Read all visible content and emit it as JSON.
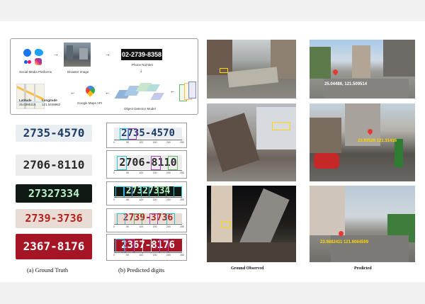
{
  "pipeline": {
    "social_label": "Social Media Platforms",
    "disaster_label": "Disaster Image",
    "phone_number": "02-2739-8358",
    "phone_label": "Phone Number",
    "detector_label": "Object Detector Model",
    "maps_label": "Google Maps API",
    "latitude_label": "Latitude",
    "latitude_value": "25.0385116",
    "longitude_label": "Longitude",
    "longitude_value": "121.5448962"
  },
  "plates": [
    {
      "gt": "2735-4570",
      "pred": "2735-4570"
    },
    {
      "gt": "2706-8110",
      "pred": "2706-8110"
    },
    {
      "gt": "27327334",
      "pred": "27327334"
    },
    {
      "gt": "2739-3736",
      "pred": "2739-3736"
    },
    {
      "gt": "2367-8176",
      "pred": "2367-8176"
    }
  ],
  "captions": {
    "a": "(a) Ground Truth",
    "b": "(b) Predicted digits"
  },
  "coords": [
    "25.04486, 121.509514",
    "23.93526 121.31416",
    "23.9882411  121.6064599"
  ],
  "photo_captions": {
    "left": "Ground Observed",
    "right": "Predicted"
  },
  "pred_axis_ticks": [
    "0",
    "50",
    "100",
    "150",
    "200",
    "250"
  ],
  "colors": {
    "pin": "#e53935",
    "coord_white": "#ffffff",
    "coord_yellow": "#ffd600",
    "box_yellow": "#ffd600"
  }
}
